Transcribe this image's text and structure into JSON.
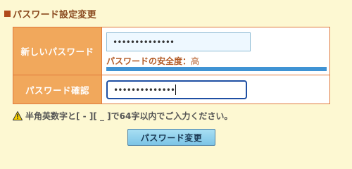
{
  "section": {
    "title": "パスワード設定変更"
  },
  "form": {
    "new_password": {
      "label": "新しいパスワード",
      "value": "••••••••••••••"
    },
    "strength": {
      "label": "パスワードの安全度：",
      "value": "高",
      "level": 1.0,
      "color": "#3f93d4"
    },
    "confirm_password": {
      "label": "パスワード確認",
      "value": "••••••••••••••"
    }
  },
  "notice": {
    "icon": "warning-icon",
    "text": "半角英数字と[ - ][ _ ]で64字以内でご入力ください。"
  },
  "submit": {
    "label": "パスワード変更"
  },
  "colors": {
    "background": "#fdf8d2",
    "label_cell": "#f1a85c",
    "border": "#e07a3c",
    "button": "#7cc4e6"
  }
}
